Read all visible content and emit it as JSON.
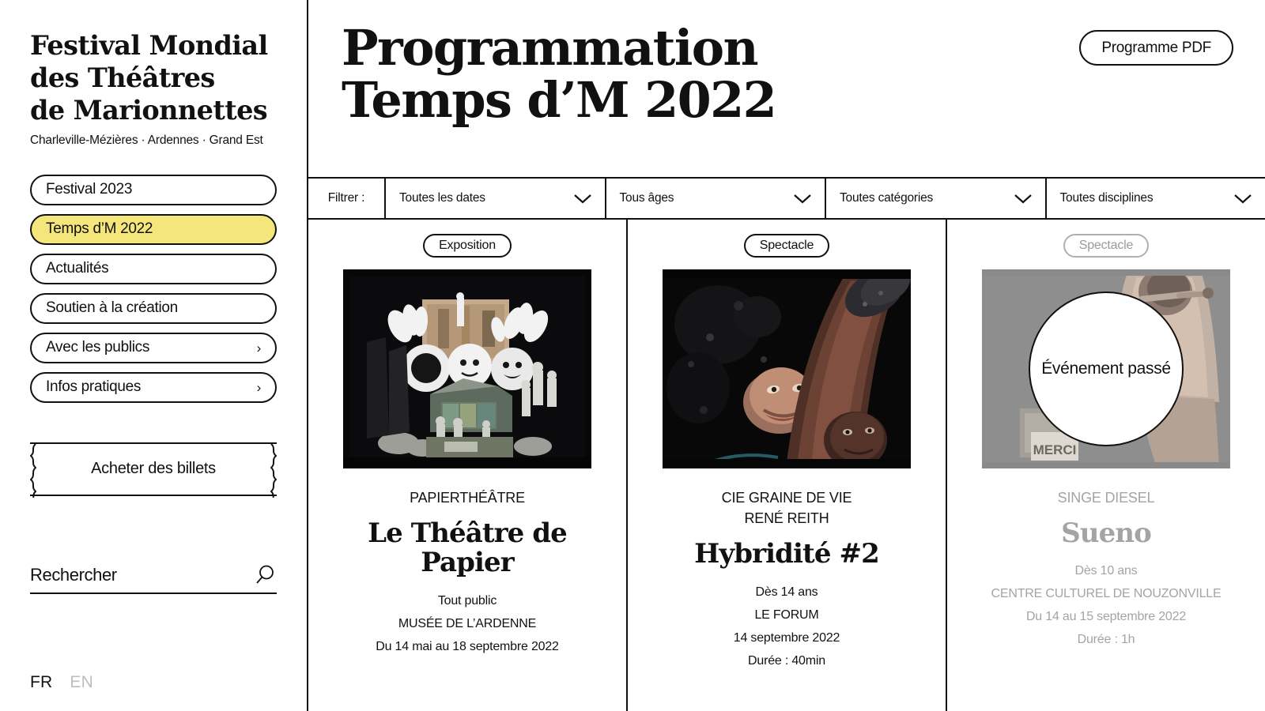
{
  "sidebar": {
    "logo": {
      "line1": "Festival Mondial",
      "line2": "des Théâtres",
      "line3": "de Marionnettes",
      "subtitle": "Charleville-Mézières · Ardennes · Grand Est"
    },
    "nav": [
      {
        "label": "Festival 2023",
        "active": false,
        "chevron": ""
      },
      {
        "label": "Temps d’M 2022",
        "active": true,
        "chevron": ""
      },
      {
        "label": "Actualités",
        "active": false,
        "chevron": ""
      },
      {
        "label": "Soutien à la création",
        "active": false,
        "chevron": ""
      },
      {
        "label": "Avec les publics",
        "active": false,
        "chevron": "›"
      },
      {
        "label": "Infos pratiques",
        "active": false,
        "chevron": "›"
      }
    ],
    "tickets_label": "Acheter des billets",
    "search_label": "Rechercher",
    "search_icon": "search-icon",
    "languages": {
      "active": "FR",
      "inactive": "EN"
    }
  },
  "header": {
    "title_line1": "Programmation",
    "title_line2": "Temps d’M 2022",
    "pdf_button": "Programme PDF"
  },
  "filters": {
    "label": "Filtrer :",
    "items": [
      {
        "value": "Toutes les dates",
        "icon": "chevron-down-icon"
      },
      {
        "value": "Tous âges",
        "icon": "chevron-down-icon"
      },
      {
        "value": "Toutes catégories",
        "icon": "chevron-down-icon"
      },
      {
        "value": "Toutes disciplines",
        "icon": "chevron-down-icon"
      }
    ]
  },
  "cards": [
    {
      "tag": "Exposition",
      "company": "PAPIERTHÉÂTRE",
      "title": "Le Théâtre de Papier",
      "audience": "Tout public",
      "venue": "MUSÉE DE L’ARDENNE",
      "dates": "Du 14 mai au 18 septembre 2022",
      "duration": "",
      "past": false,
      "overlay": ""
    },
    {
      "tag": "Spectacle",
      "company": "CIE GRAINE DE VIE\nRENÉ REITH",
      "title": "Hybridité #2",
      "audience": "Dès 14 ans",
      "venue": "LE FORUM",
      "dates": "14 septembre 2022",
      "duration": "Durée : 40min",
      "past": false,
      "overlay": ""
    },
    {
      "tag": "Spectacle",
      "company": "SINGE DIESEL",
      "title": "Sueno",
      "audience": "Dès 10 ans",
      "venue": "CENTRE CULTUREL DE NOUZONVILLE",
      "dates": "Du 14 au 15 septembre 2022",
      "duration": "Durée : 1h",
      "past": true,
      "overlay": "Événement passé"
    }
  ],
  "colors": {
    "accent_yellow": "#f5e67c",
    "ink": "#111111",
    "muted": "#a4a4a4",
    "past_overlay_bg": "#8d8d8d"
  }
}
